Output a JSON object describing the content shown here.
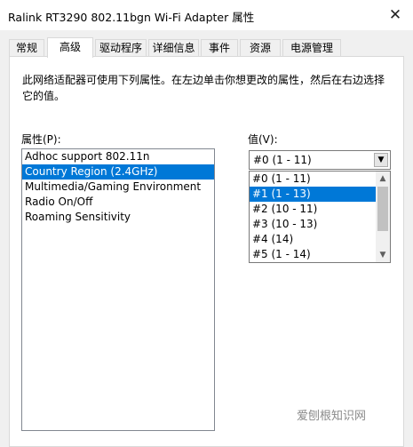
{
  "window": {
    "title": "Ralink RT3290 802.11bgn Wi-Fi Adapter 属性",
    "close_glyph": "✕"
  },
  "tabs": [
    {
      "label": "常规"
    },
    {
      "label": "高级"
    },
    {
      "label": "驱动程序"
    },
    {
      "label": "详细信息"
    },
    {
      "label": "事件"
    },
    {
      "label": "资源"
    },
    {
      "label": "电源管理"
    }
  ],
  "active_tab": "高级",
  "description": "此网络适配器可使用下列属性。在左边单击你想更改的属性，然后在右边选择它的值。",
  "property_label": "属性(P):",
  "value_label": "值(V):",
  "properties": [
    {
      "label": "Adhoc support 802.11n"
    },
    {
      "label": "Country Region (2.4GHz)"
    },
    {
      "label": "Multimedia/Gaming Environment"
    },
    {
      "label": "Radio On/Off"
    },
    {
      "label": "Roaming Sensitivity"
    }
  ],
  "selected_property": "Country Region (2.4GHz)",
  "value_combo": {
    "current": "#0 (1 - 11)",
    "arrow": "▼"
  },
  "value_options": [
    {
      "label": "#0 (1 - 11)"
    },
    {
      "label": "#1 (1 - 13)"
    },
    {
      "label": "#2 (10 - 11)"
    },
    {
      "label": "#3 (10 - 13)"
    },
    {
      "label": "#4 (14)"
    },
    {
      "label": "#5 (1 - 14)"
    }
  ],
  "highlighted_option": "#1 (1 - 13)",
  "scroll": {
    "up": "▲",
    "down": "▼"
  },
  "watermark": "爱刨根知识网",
  "colors": {
    "selection": "#0078d7",
    "background": "#f0f0f0"
  }
}
